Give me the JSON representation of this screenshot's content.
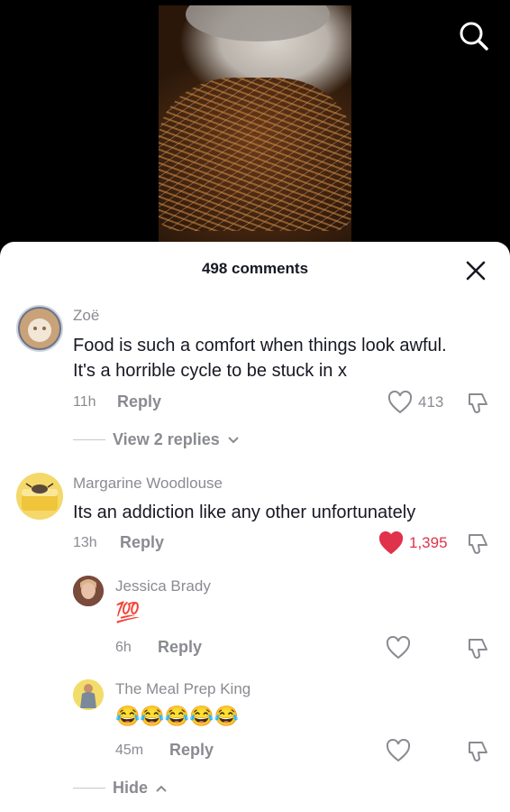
{
  "header": {
    "comment_count_label": "498 comments"
  },
  "icons": {
    "search": "search-icon",
    "close": "close-icon",
    "heart": "heart-icon",
    "dislike": "thumbs-down-icon",
    "chevron": "chevron-icon"
  },
  "colors": {
    "liked": "#e0324b",
    "muted": "#8a8b91",
    "text": "#161823"
  },
  "comments": [
    {
      "author": "Zoë",
      "text": "Food is such a comfort when things look awful. It's a horrible cycle to be stuck in x",
      "time": "11h",
      "reply_label": "Reply",
      "likes": "413",
      "liked": false,
      "view_replies_label": "View 2 replies"
    },
    {
      "author": "Margarine Woodlouse",
      "text": "Its an addiction like any other unfortunately",
      "time": "13h",
      "reply_label": "Reply",
      "likes": "1,395",
      "liked": true,
      "replies": [
        {
          "author": "Jessica Brady",
          "text": "💯",
          "time": "6h",
          "reply_label": "Reply"
        },
        {
          "author": "The Meal Prep King",
          "text": "😂😂😂😂😂",
          "time": "45m",
          "reply_label": "Reply"
        }
      ],
      "hide_label": "Hide"
    }
  ]
}
